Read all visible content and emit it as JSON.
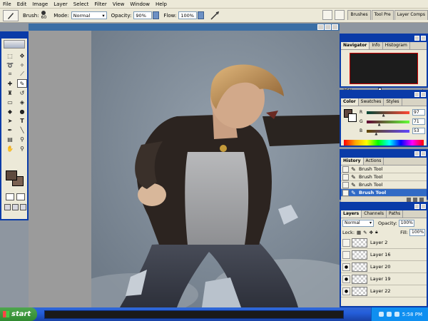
{
  "menu": [
    "File",
    "Edit",
    "Image",
    "Layer",
    "Select",
    "Filter",
    "View",
    "Window",
    "Help"
  ],
  "options": {
    "brush_label": "Brush:",
    "brush_size": "60",
    "mode_label": "Mode:",
    "mode_value": "Normal",
    "opacity_label": "Opacity:",
    "opacity_value": "90%",
    "flow_label": "Flow:",
    "flow_value": "100%"
  },
  "palette_well": [
    "Brushes",
    "Tool Pre",
    "Layer Comps"
  ],
  "navigator": {
    "tabs": [
      "Navigator",
      "Info",
      "Histogram"
    ],
    "zoom": "25%"
  },
  "color": {
    "tabs": [
      "Color",
      "Swatches",
      "Styles"
    ],
    "r_label": "R",
    "r_value": "97",
    "g_label": "G",
    "g_value": "71",
    "b_label": "B",
    "b_value": "53",
    "fg_color": "#61473f"
  },
  "history": {
    "tabs": [
      "History",
      "Actions"
    ],
    "items": [
      "Brush Tool",
      "Brush Tool",
      "Brush Tool",
      "Brush Tool"
    ],
    "selected_index": 3
  },
  "layers": {
    "tabs": [
      "Layers",
      "Channels",
      "Paths"
    ],
    "blend_mode": "Normal",
    "opacity_label": "Opacity:",
    "opacity_value": "100%",
    "lock_label": "Lock:",
    "fill_label": "Fill:",
    "fill_value": "100%",
    "items": [
      "Layer 2",
      "Layer 16",
      "Layer 20",
      "Layer 19",
      "Layer 22"
    ]
  },
  "taskbar": {
    "start_label": "start",
    "clock": "5:58 PM"
  },
  "colors": {
    "title_blue": "#0a3ba8",
    "xp_taskbar": "#245edb",
    "start_green": "#3c9a3c",
    "selection_blue": "#316ac5",
    "canvas_bg": "#7b8794"
  }
}
